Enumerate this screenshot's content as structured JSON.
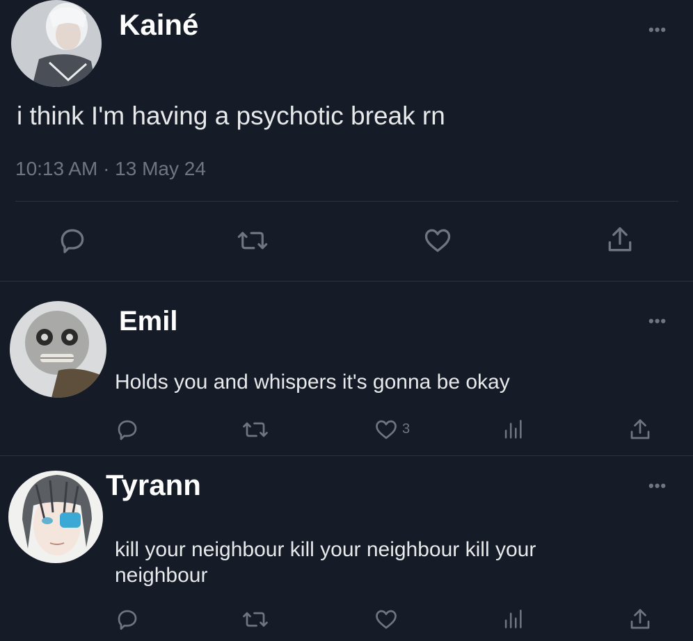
{
  "main_tweet": {
    "author": "Kainé",
    "text": "i think I'm having a psychotic break rn",
    "timestamp": "10:13 AM · 13 May 24",
    "more_label": "•••",
    "actions": [
      "reply-icon",
      "retweet-icon",
      "like-icon",
      "share-icon"
    ]
  },
  "replies": [
    {
      "author": "Emil",
      "text": "Holds you and whispers it's gonna be okay",
      "more_label": "•••",
      "like_count": "3"
    },
    {
      "author": "Tyrann",
      "text": "kill your neighbour kill your neighbour kill your neighbour",
      "more_label": "•••",
      "like_count": ""
    }
  ],
  "colors": {
    "background": "#151c28",
    "text": "#e7e9ea",
    "muted": "#6e7780",
    "divider": "#2a3340"
  }
}
